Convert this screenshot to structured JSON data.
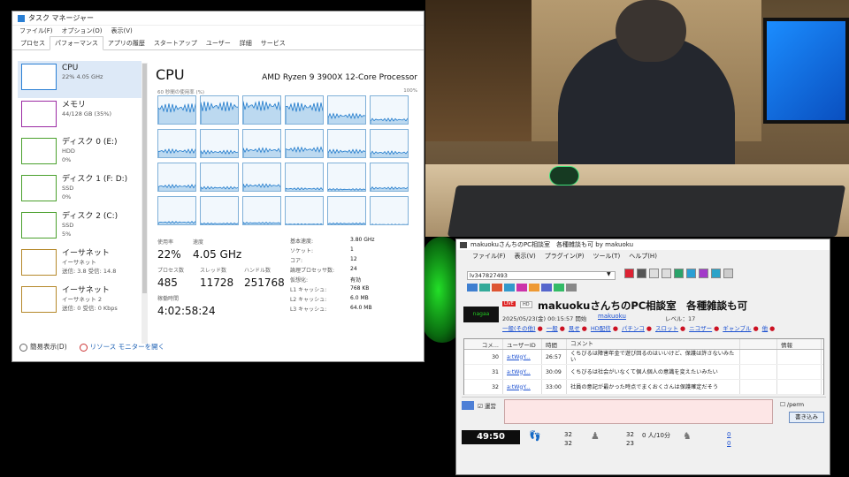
{
  "task_manager": {
    "title": "タスク マネージャー",
    "menu": [
      "ファイル(F)",
      "オプション(O)",
      "表示(V)"
    ],
    "tabs": [
      "プロセス",
      "パフォーマンス",
      "アプリの履歴",
      "スタートアップ",
      "ユーザー",
      "詳細",
      "サービス"
    ],
    "active_tab": "パフォーマンス",
    "sidebar": [
      {
        "name": "CPU",
        "l1": "22%  4.05 GHz",
        "l2": "",
        "l3": "",
        "color": "#2a7fd4"
      },
      {
        "name": "メモリ",
        "l1": "44/128 GB (35%)",
        "l2": "",
        "l3": "",
        "color": "#9b2aa3"
      },
      {
        "name": "ディスク 0 (E:)",
        "l1": "HDD",
        "l2": "0%",
        "l3": "",
        "color": "#4aa02c"
      },
      {
        "name": "ディスク 1 (F: D:)",
        "l1": "SSD",
        "l2": "0%",
        "l3": "",
        "color": "#4aa02c"
      },
      {
        "name": "ディスク 2 (C:)",
        "l1": "SSD",
        "l2": "5%",
        "l3": "",
        "color": "#4aa02c"
      },
      {
        "name": "イーサネット",
        "l1": "イーサネット",
        "l2": "送信: 3.8  受信: 14.8",
        "l3": "",
        "color": "#b5882a"
      },
      {
        "name": "イーサネット",
        "l1": "イーサネット 2",
        "l2": "送信: 0  受信: 0 Kbps",
        "l3": "",
        "color": "#b5882a"
      }
    ],
    "cpu_title": "CPU",
    "cpu_model": "AMD Ryzen 9 3900X 12-Core Processor",
    "graph_left_label": "60 秒間の使用率 (%)",
    "graph_right_label": "100%",
    "core_loads": [
      0.55,
      0.6,
      0.62,
      0.58,
      0.3,
      0.18,
      0.25,
      0.22,
      0.28,
      0.3,
      0.24,
      0.2,
      0.2,
      0.15,
      0.22,
      0.12,
      0.1,
      0.14,
      0.12,
      0.08,
      0.1,
      0.06,
      0.08,
      0.05
    ],
    "stats": {
      "usage_label": "使用率",
      "usage": "22%",
      "speed_label": "速度",
      "speed": "4.05 GHz",
      "process_label": "プロセス数",
      "processes": "485",
      "thread_label": "スレッド数",
      "threads": "11728",
      "handle_label": "ハンドル数",
      "handles": "251768",
      "uptime_label": "稼働時間",
      "uptime": "4:02:58:24"
    },
    "specs": [
      {
        "k": "基本速度:",
        "v": "3.80 GHz"
      },
      {
        "k": "ソケット:",
        "v": "1"
      },
      {
        "k": "コア:",
        "v": "12"
      },
      {
        "k": "論理プロセッサ数:",
        "v": "24"
      },
      {
        "k": "仮想化:",
        "v": "有効"
      },
      {
        "k": "L1 キャッシュ:",
        "v": "768 KB"
      },
      {
        "k": "L2 キャッシュ:",
        "v": "6.0 MB"
      },
      {
        "k": "L3 キャッシュ:",
        "v": "64.0 MB"
      }
    ],
    "footer_brief": "簡易表示(D)",
    "footer_monitor": "リソース モニターを開く"
  },
  "viewer": {
    "title": "makuokuさんちのPC相談室　各種雑談も可 by makuoku",
    "menu": [
      "ファイル(F)",
      "表示(V)",
      "プラグイン(P)",
      "ツール(T)",
      "ヘルプ(H)"
    ],
    "lv": "lv347827493",
    "logo": "nagaa",
    "badge1": "LIVE",
    "badge2": "HD",
    "room": "makuokuさんちのPC相談室　各種雑談も可",
    "date": "2025/05/23(金) 00:15:57 開始",
    "owner": "makuoku",
    "level": "レベル：17",
    "tags": [
      "一般(その他)",
      "一般",
      "見せ",
      "HD配信",
      "パチンコ",
      "スロット",
      "ニコザー",
      "ギャンブル",
      "他"
    ],
    "columns": [
      "コメ...",
      "ユーザーID",
      "時間",
      "コメント",
      "",
      "情報"
    ],
    "rows": [
      {
        "no": "30",
        "uid": "a:tWgY...",
        "time": "26:57",
        "comment": "くちびるは障害年金で遊び回るのはいいけど、保護は許さないみたい"
      },
      {
        "no": "31",
        "uid": "a:tWgY...",
        "time": "30:09",
        "comment": "くちびるは社会がいなくて個人個人の意識を変えたいみたい"
      },
      {
        "no": "32",
        "uid": "a:tWgY...",
        "time": "33:00",
        "comment": "社員の意記が最かった時点でまくおくさんは保護確定だそう"
      }
    ],
    "checkbox_label": "運営",
    "perm_label": "/perm",
    "write_button": "書き込み",
    "timer": "49:50",
    "foot_nums": {
      "a1": "32",
      "a2": "32",
      "b1": "32",
      "b2": "23",
      "c1": "0 人/10分",
      "d1": "0",
      "d2": "0"
    }
  }
}
